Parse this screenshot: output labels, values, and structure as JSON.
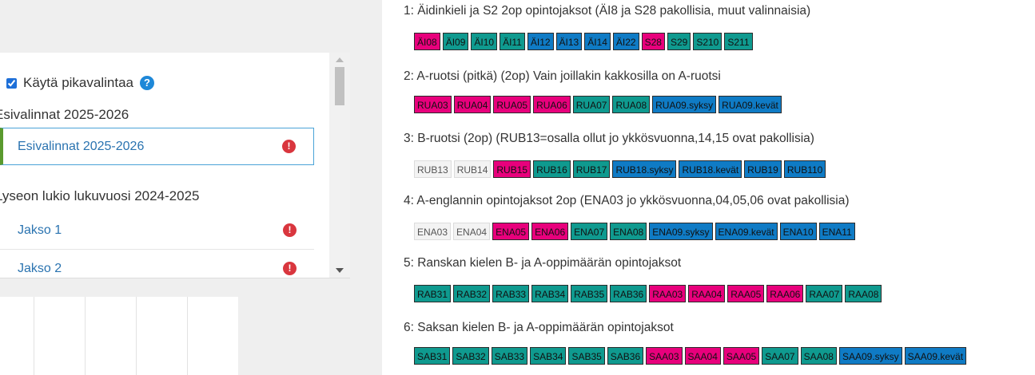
{
  "left": {
    "pikavalinta": {
      "label": "Käytä pikavalintaa",
      "checked": true,
      "help_icon": "question-circle-icon",
      "help_glyph": "?"
    },
    "groups": [
      {
        "heading": "Esivalinnat 2025-2026",
        "items": [
          {
            "label": "Esivalinnat 2025-2026",
            "status_icon": "error-icon",
            "status_glyph": "!",
            "active": true
          }
        ]
      },
      {
        "heading": "Lyseon lukio lukuvuosi 2024-2025",
        "items": [
          {
            "label": "Jakso 1",
            "status_icon": "error-icon",
            "status_glyph": "!"
          },
          {
            "label": "Jakso 2",
            "status_icon": "error-icon",
            "status_glyph": "!"
          }
        ]
      }
    ]
  },
  "colors": {
    "pink": "#e8007c",
    "teal": "#0f9a8f",
    "blue": "#0f7bc5",
    "grey": "#f3f3f3"
  },
  "sections": [
    {
      "title": "1: Äidinkieli ja S2 2op opintojaksot (ÄI8 ja S28 pakollisia, muut valinnaisia)",
      "courses": [
        {
          "code": "ÄI08",
          "color": "pink"
        },
        {
          "code": "ÄI09",
          "color": "teal"
        },
        {
          "code": "ÄI10",
          "color": "teal"
        },
        {
          "code": "ÄI11",
          "color": "teal"
        },
        {
          "code": "ÄI12",
          "color": "blue"
        },
        {
          "code": "ÄI13",
          "color": "blue"
        },
        {
          "code": "ÄI14",
          "color": "blue"
        },
        {
          "code": "ÄI22",
          "color": "blue"
        },
        {
          "code": "S28",
          "color": "pink"
        },
        {
          "code": "S29",
          "color": "teal"
        },
        {
          "code": "S210",
          "color": "teal"
        },
        {
          "code": "S211",
          "color": "teal"
        }
      ]
    },
    {
      "title": "2: A-ruotsi (pitkä) (2op) Vain joillakin kakkosilla on A-ruotsi",
      "courses": [
        {
          "code": "RUA03",
          "color": "pink"
        },
        {
          "code": "RUA04",
          "color": "pink"
        },
        {
          "code": "RUA05",
          "color": "pink"
        },
        {
          "code": "RUA06",
          "color": "pink"
        },
        {
          "code": "RUA07",
          "color": "teal"
        },
        {
          "code": "RUA08",
          "color": "teal"
        },
        {
          "code": "RUA09.syksy",
          "color": "blue"
        },
        {
          "code": "RUA09.kevät",
          "color": "blue"
        }
      ]
    },
    {
      "title": "3: B-ruotsi (2op) (RUB13=osalla ollut jo ykkösvuonna,14,15 ovat pakollisia)",
      "courses": [
        {
          "code": "RUB13",
          "color": "grey"
        },
        {
          "code": "RUB14",
          "color": "grey"
        },
        {
          "code": "RUB15",
          "color": "pink"
        },
        {
          "code": "RUB16",
          "color": "teal"
        },
        {
          "code": "RUB17",
          "color": "teal"
        },
        {
          "code": "RUB18.syksy",
          "color": "blue"
        },
        {
          "code": "RUB18.kevät",
          "color": "blue"
        },
        {
          "code": "RUB19",
          "color": "blue"
        },
        {
          "code": "RUB110",
          "color": "blue"
        }
      ]
    },
    {
      "title": "4: A-englannin opintojaksot 2op (ENA03 jo ykkösvuonna,04,05,06 ovat pakollisia)",
      "courses": [
        {
          "code": "ENA03",
          "color": "grey"
        },
        {
          "code": "ENA04",
          "color": "grey"
        },
        {
          "code": "ENA05",
          "color": "pink"
        },
        {
          "code": "ENA06",
          "color": "pink"
        },
        {
          "code": "ENA07",
          "color": "teal"
        },
        {
          "code": "ENA08",
          "color": "teal"
        },
        {
          "code": "ENA09.syksy",
          "color": "blue"
        },
        {
          "code": "ENA09.kevät",
          "color": "blue"
        },
        {
          "code": "ENA10",
          "color": "blue"
        },
        {
          "code": "ENA11",
          "color": "blue"
        }
      ]
    },
    {
      "title": "5: Ranskan kielen B- ja A-oppimäärän opintojaksot",
      "courses": [
        {
          "code": "RAB31",
          "color": "teal"
        },
        {
          "code": "RAB32",
          "color": "teal"
        },
        {
          "code": "RAB33",
          "color": "teal"
        },
        {
          "code": "RAB34",
          "color": "teal"
        },
        {
          "code": "RAB35",
          "color": "teal"
        },
        {
          "code": "RAB36",
          "color": "teal"
        },
        {
          "code": "RAA03",
          "color": "pink"
        },
        {
          "code": "RAA04",
          "color": "pink"
        },
        {
          "code": "RAA05",
          "color": "pink"
        },
        {
          "code": "RAA06",
          "color": "pink"
        },
        {
          "code": "RAA07",
          "color": "teal"
        },
        {
          "code": "RAA08",
          "color": "teal"
        }
      ]
    },
    {
      "title": "6: Saksan kielen B- ja A-oppimäärän opintojaksot",
      "courses": [
        {
          "code": "SAB31",
          "color": "teal"
        },
        {
          "code": "SAB32",
          "color": "teal"
        },
        {
          "code": "SAB33",
          "color": "teal"
        },
        {
          "code": "SAB34",
          "color": "teal"
        },
        {
          "code": "SAB35",
          "color": "teal"
        },
        {
          "code": "SAB36",
          "color": "teal"
        },
        {
          "code": "SAA03",
          "color": "pink"
        },
        {
          "code": "SAA04",
          "color": "pink"
        },
        {
          "code": "SAA05",
          "color": "pink"
        },
        {
          "code": "SAA07",
          "color": "teal"
        },
        {
          "code": "SAA08",
          "color": "teal"
        },
        {
          "code": "SAA09.syksy",
          "color": "blue"
        },
        {
          "code": "SAA09.kevät",
          "color": "blue"
        }
      ]
    }
  ]
}
